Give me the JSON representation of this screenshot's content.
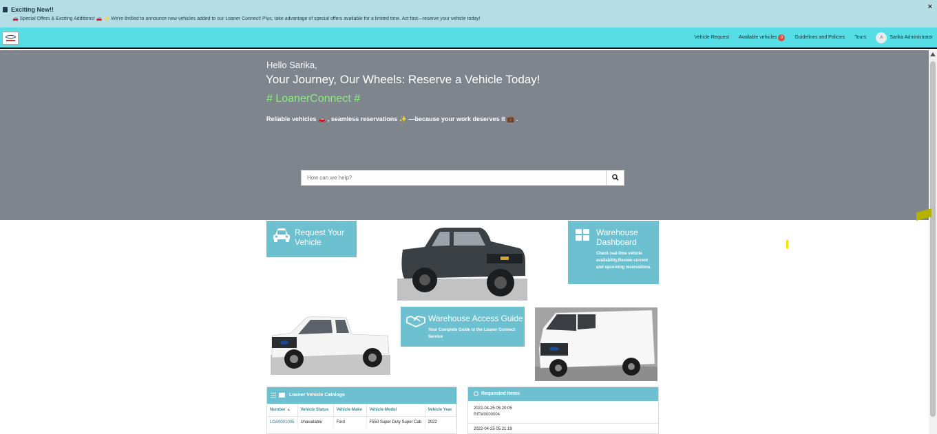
{
  "banner": {
    "title": "Exciting New!!",
    "message": "🚗 Special Offers & Exciting Additions! 🚗 ✨ We're thrilled to announce new vehicles added to our Loaner Connect! Plus, take advantage of special offers available for a limited time. Act fast—reserve your vehicle today!",
    "close_label": "×",
    "icon": "megaphone-icon"
  },
  "navbar": {
    "logo_text": "LOANER",
    "items": [
      {
        "label": "Vehicle Request"
      },
      {
        "label": "Available vehicles",
        "badge": "0"
      },
      {
        "label": "Guidelines and Policies"
      },
      {
        "label": "Tours"
      }
    ],
    "user": {
      "initial": "A",
      "name": "Sarika Administrator"
    }
  },
  "hero": {
    "greeting": "Hello Sarika,",
    "headline": "Your Journey, Our Wheels: Reserve a Vehicle Today!",
    "hashtag": "# LoanerConnect #",
    "subtitle": "Reliable vehicles 🚗 , seamless reservations ✨ —because your work deserves it 💼 .",
    "search_placeholder": "How can we help?",
    "search_icon": "search-icon"
  },
  "tiles": {
    "request": {
      "title": "Request Your Vehicle",
      "icon": "car-icon"
    },
    "warehouse": {
      "title": "Warehouse Dashboard",
      "description": "Check real-time vehicle availability,Review current and upcoming reservations.",
      "icon": "dashboard-grid-icon"
    },
    "guide": {
      "title": "Warehouse Access Guide",
      "description": "Your Complete Guide to the Loaner Connect Service",
      "icon": "handshake-icon"
    }
  },
  "catalog": {
    "title": "Loaner Vehicle Catalogs",
    "columns": [
      "Number",
      "Vehicle Status",
      "Vehicle Make",
      "Vehicle Model",
      "Vehicle Year"
    ],
    "sort_indicator": "▲",
    "rows": [
      {
        "number": "LOA0001005",
        "status": "Unavailable",
        "make": "Ford",
        "model": "F550 Super Duty Super Cab",
        "year": "2022"
      }
    ]
  },
  "requested": {
    "title": "Requested Items",
    "items": [
      {
        "date": "2022-04-25 05:20:05",
        "ritm": "RITM0000004"
      },
      {
        "date": "2022-04-25 05:21:19",
        "ritm": ""
      }
    ]
  },
  "colors": {
    "banner_bg": "#b5dde6",
    "navbar_bg": "#56dde5",
    "hero_bg": "#7f858c",
    "tile_bg": "#6cc0d0",
    "hashtag": "#88f07a"
  }
}
